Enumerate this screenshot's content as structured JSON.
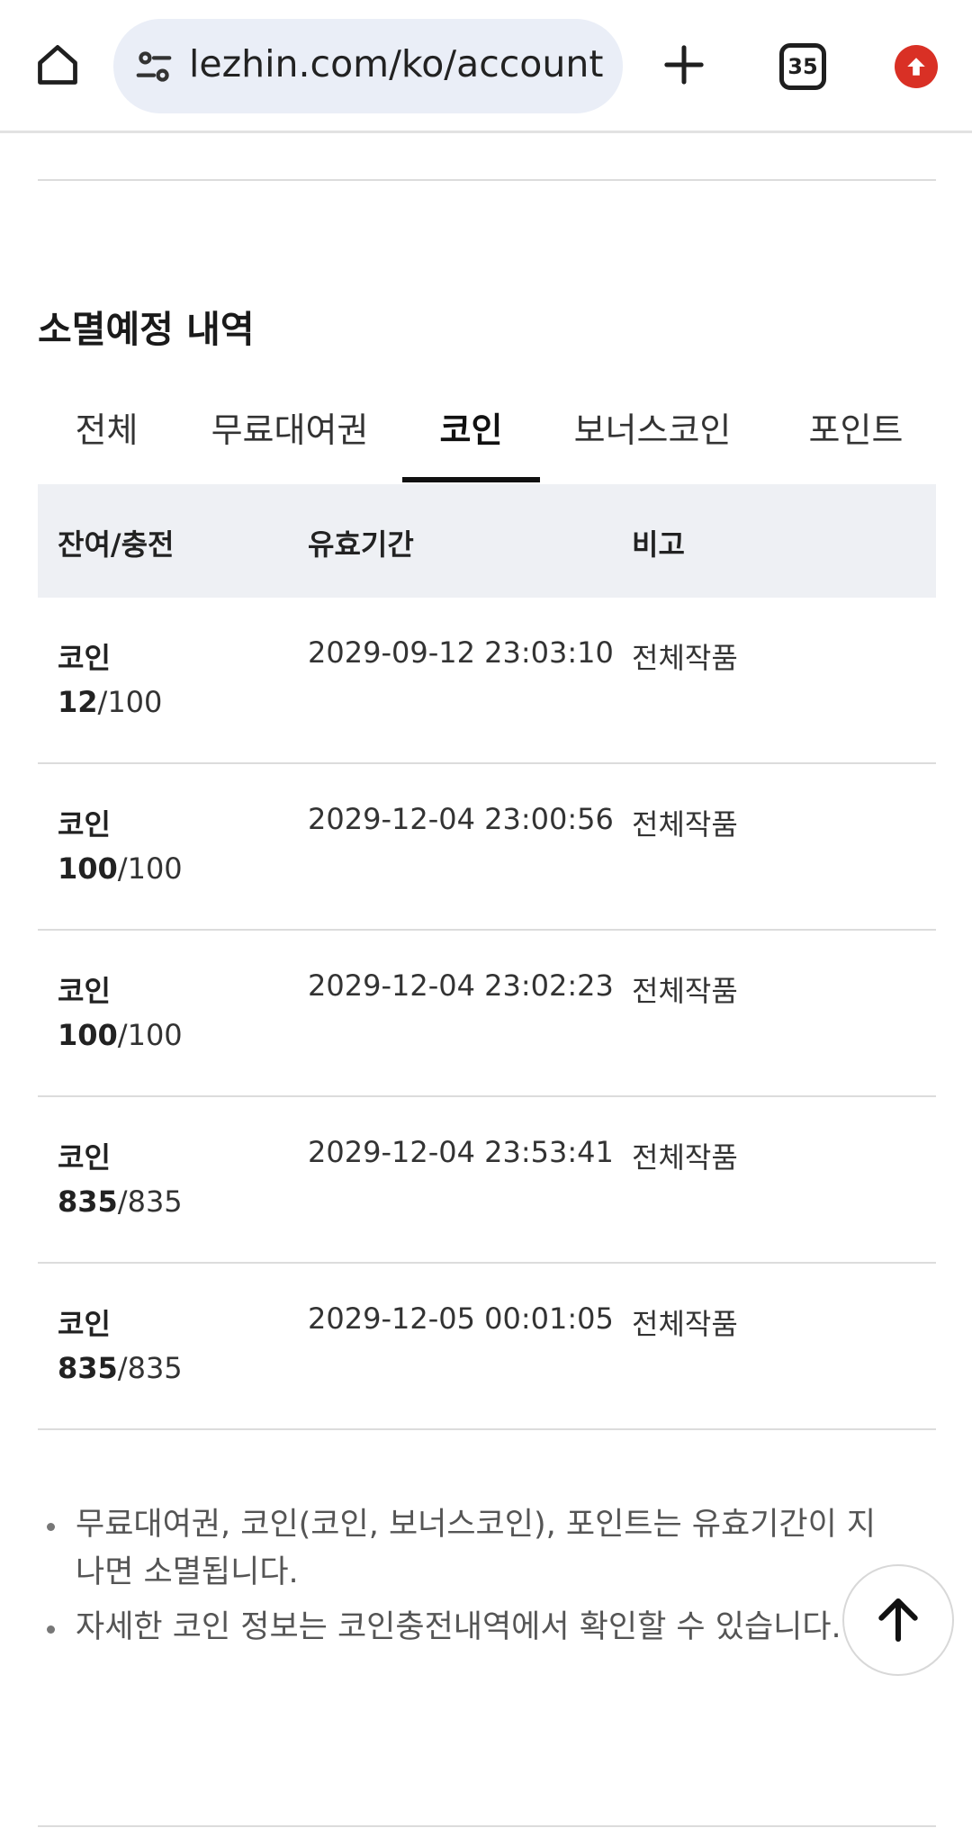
{
  "browser": {
    "url": "lezhin.com/ko/account",
    "tab_count": "35"
  },
  "section": {
    "title": "소멸예정 내역"
  },
  "tabs": [
    {
      "label": "전체"
    },
    {
      "label": "무료대여권"
    },
    {
      "label": "코인",
      "active": true
    },
    {
      "label": "보너스코인"
    },
    {
      "label": "포인트"
    }
  ],
  "table": {
    "headers": {
      "balance": "잔여/충전",
      "validity": "유효기간",
      "note": "비고"
    },
    "rows": [
      {
        "type": "코인",
        "remaining": "12",
        "total": "/100",
        "expires": "2029-09-12 23:03:10",
        "note": "전체작품"
      },
      {
        "type": "코인",
        "remaining": "100",
        "total": "/100",
        "expires": "2029-12-04 23:00:56",
        "note": "전체작품"
      },
      {
        "type": "코인",
        "remaining": "100",
        "total": "/100",
        "expires": "2029-12-04 23:02:23",
        "note": "전체작품"
      },
      {
        "type": "코인",
        "remaining": "835",
        "total": "/835",
        "expires": "2029-12-04 23:53:41",
        "note": "전체작품"
      },
      {
        "type": "코인",
        "remaining": "835",
        "total": "/835",
        "expires": "2029-12-05 00:01:05",
        "note": "전체작품"
      }
    ]
  },
  "notes": [
    "무료대여권, 코인(코인, 보너스코인), 포인트는 유효기간이 지나면 소멸됩니다.",
    "자세한 코인 정보는 코인충전내역에서 확인할 수 있습니다."
  ],
  "colors": {
    "update_badge": "#d93025",
    "url_bar": "#eaeef7",
    "table_header": "#eef0f4"
  }
}
